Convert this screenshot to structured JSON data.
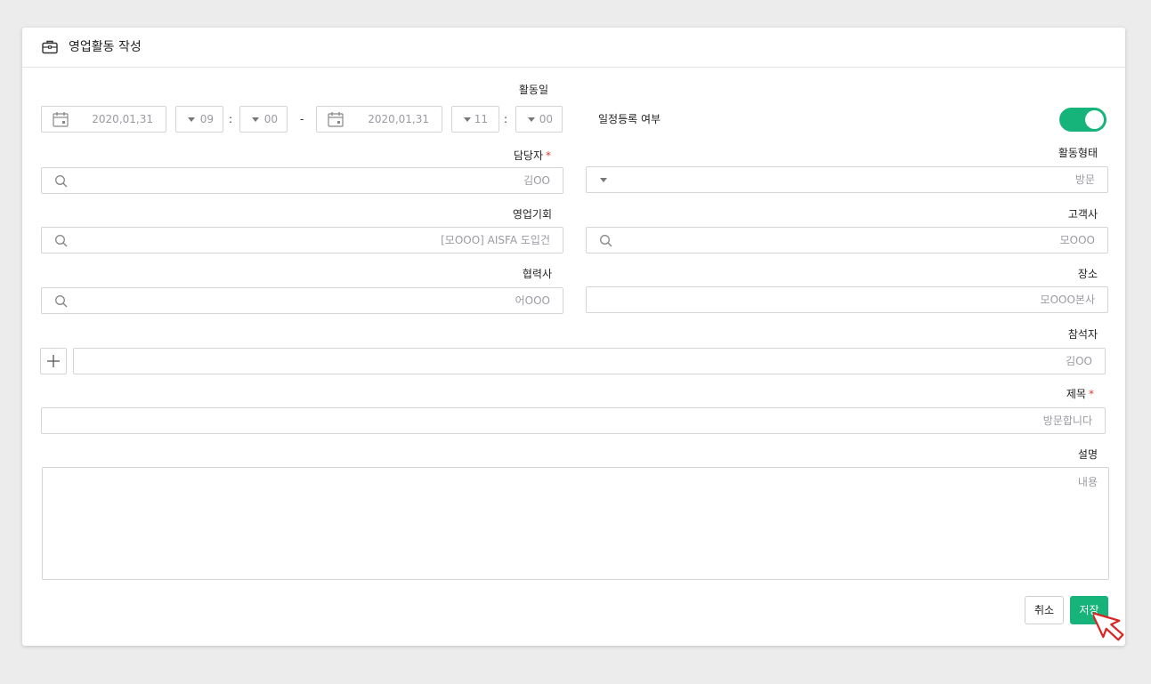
{
  "header": {
    "title": "영업활동 작성",
    "icon": "briefcase-icon"
  },
  "activity_date": {
    "label": "활동일",
    "start_date": "2020,01,31",
    "start_hour": "09",
    "start_minute": "00",
    "range_sep": "-",
    "end_date": "2020,01,31",
    "end_hour": "11",
    "end_minute": "00",
    "colon": ":"
  },
  "schedule_register": {
    "label": "일정등록 여부",
    "enabled": true,
    "accent": "#16b47a"
  },
  "owner": {
    "label": "담당자",
    "required": "*",
    "value": "김OO"
  },
  "activity_type": {
    "label": "활동형태",
    "value": "방문"
  },
  "opportunity": {
    "label": "영업기회",
    "value": "[모OOO] AISFA 도입건"
  },
  "customer": {
    "label": "고객사",
    "value": "모OOO"
  },
  "partner": {
    "label": "협력사",
    "value": "어OOO"
  },
  "location": {
    "label": "장소",
    "value": "모OOO본사"
  },
  "attendees": {
    "label": "참석자",
    "value": "김OO"
  },
  "subject": {
    "label": "제목",
    "required": "*",
    "value": "방문합니다"
  },
  "description": {
    "label": "설명",
    "placeholder": "내용"
  },
  "buttons": {
    "cancel": "취소",
    "save": "저장"
  }
}
